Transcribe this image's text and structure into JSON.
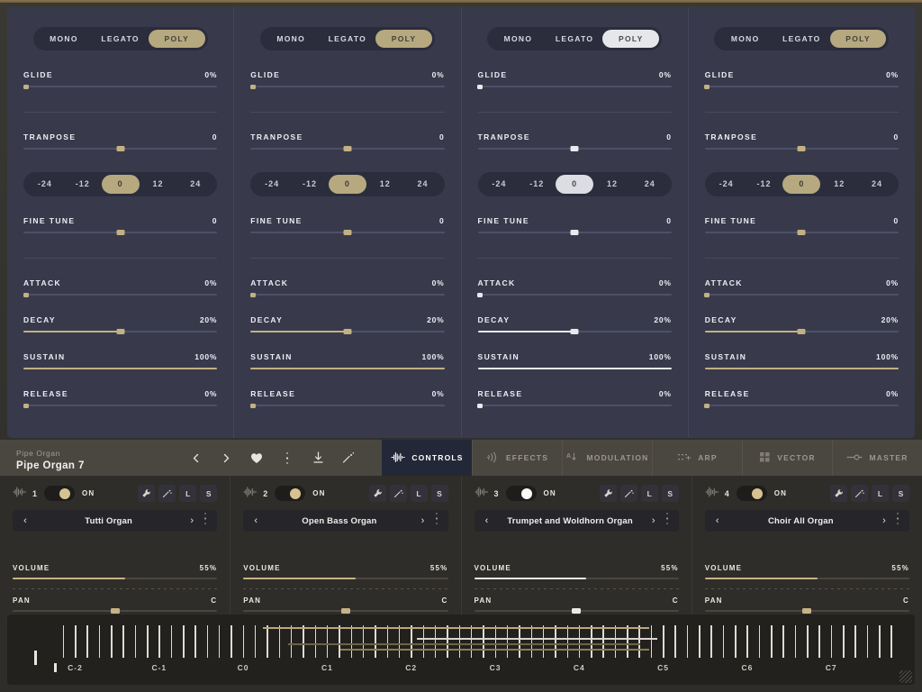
{
  "colors": {
    "panel_bg": "#383a4b",
    "accent_gold": "#c2b183",
    "accent_white": "#e9eaee",
    "toolbar_bg": "#4a4741",
    "tab_active_bg": "#232838",
    "wood": "#8a7550"
  },
  "panels": [
    {
      "active": false,
      "mode": {
        "options": [
          "MONO",
          "LEGATO",
          "POLY"
        ],
        "selected": "POLY"
      },
      "glide": {
        "label": "GLIDE",
        "value": "0%",
        "pct": 0
      },
      "transpose": {
        "label": "TRANPOSE",
        "value": "0",
        "pct": 50
      },
      "transpose_steps": {
        "options": [
          "-24",
          "-12",
          "0",
          "12",
          "24"
        ],
        "selected": "0"
      },
      "fine_tune": {
        "label": "FINE TUNE",
        "value": "0",
        "pct": 50
      },
      "attack": {
        "label": "ATTACK",
        "value": "0%",
        "pct": 0
      },
      "decay": {
        "label": "DECAY",
        "value": "20%",
        "pct": 50
      },
      "sustain": {
        "label": "SUSTAIN",
        "value": "100%",
        "pct": 100
      },
      "release": {
        "label": "RELEASE",
        "value": "0%",
        "pct": 0
      }
    },
    {
      "active": false,
      "mode": {
        "options": [
          "MONO",
          "LEGATO",
          "POLY"
        ],
        "selected": "POLY"
      },
      "glide": {
        "label": "GLIDE",
        "value": "0%",
        "pct": 0
      },
      "transpose": {
        "label": "TRANPOSE",
        "value": "0",
        "pct": 50
      },
      "transpose_steps": {
        "options": [
          "-24",
          "-12",
          "0",
          "12",
          "24"
        ],
        "selected": "0"
      },
      "fine_tune": {
        "label": "FINE TUNE",
        "value": "0",
        "pct": 50
      },
      "attack": {
        "label": "ATTACK",
        "value": "0%",
        "pct": 0
      },
      "decay": {
        "label": "DECAY",
        "value": "20%",
        "pct": 50
      },
      "sustain": {
        "label": "SUSTAIN",
        "value": "100%",
        "pct": 100
      },
      "release": {
        "label": "RELEASE",
        "value": "0%",
        "pct": 0
      }
    },
    {
      "active": true,
      "mode": {
        "options": [
          "MONO",
          "LEGATO",
          "POLY"
        ],
        "selected": "POLY"
      },
      "glide": {
        "label": "GLIDE",
        "value": "0%",
        "pct": 0
      },
      "transpose": {
        "label": "TRANPOSE",
        "value": "0",
        "pct": 50
      },
      "transpose_steps": {
        "options": [
          "-24",
          "-12",
          "0",
          "12",
          "24"
        ],
        "selected": "0"
      },
      "fine_tune": {
        "label": "FINE TUNE",
        "value": "0",
        "pct": 50
      },
      "attack": {
        "label": "ATTACK",
        "value": "0%",
        "pct": 0
      },
      "decay": {
        "label": "DECAY",
        "value": "20%",
        "pct": 50
      },
      "sustain": {
        "label": "SUSTAIN",
        "value": "100%",
        "pct": 100
      },
      "release": {
        "label": "RELEASE",
        "value": "0%",
        "pct": 0
      }
    },
    {
      "active": false,
      "mode": {
        "options": [
          "MONO",
          "LEGATO",
          "POLY"
        ],
        "selected": "POLY"
      },
      "glide": {
        "label": "GLIDE",
        "value": "0%",
        "pct": 0
      },
      "transpose": {
        "label": "TRANPOSE",
        "value": "0",
        "pct": 50
      },
      "transpose_steps": {
        "options": [
          "-24",
          "-12",
          "0",
          "12",
          "24"
        ],
        "selected": "0"
      },
      "fine_tune": {
        "label": "FINE TUNE",
        "value": "0",
        "pct": 50
      },
      "attack": {
        "label": "ATTACK",
        "value": "0%",
        "pct": 0
      },
      "decay": {
        "label": "DECAY",
        "value": "20%",
        "pct": 50
      },
      "sustain": {
        "label": "SUSTAIN",
        "value": "100%",
        "pct": 100
      },
      "release": {
        "label": "RELEASE",
        "value": "0%",
        "pct": 0
      }
    }
  ],
  "toolbar": {
    "preset_category": "Pipe Organ",
    "preset_name": "Pipe Organ 7",
    "icons": [
      {
        "name": "prev-preset-icon",
        "glyph": "prev"
      },
      {
        "name": "next-preset-icon",
        "glyph": "next"
      },
      {
        "name": "favorite-heart-icon",
        "glyph": "heart"
      },
      {
        "name": "more-options-icon",
        "glyph": "dots"
      },
      {
        "name": "download-icon",
        "glyph": "download"
      },
      {
        "name": "randomize-icon",
        "glyph": "sparkle"
      }
    ],
    "tabs": [
      {
        "label": "CONTROLS",
        "icon": "waveform-icon",
        "active": true
      },
      {
        "label": "EFFECTS",
        "icon": "signal-icon",
        "active": false
      },
      {
        "label": "MODULATION",
        "icon": "modulation-icon",
        "active": false
      },
      {
        "label": "ARP",
        "icon": "arp-icon",
        "active": false
      },
      {
        "label": "VECTOR",
        "icon": "grid-icon",
        "active": false
      },
      {
        "label": "MASTER",
        "icon": "master-icon",
        "active": false
      }
    ]
  },
  "layers": [
    {
      "number": "1",
      "power": "ON",
      "enabled": true,
      "active": false,
      "buttons": [
        "wrench-icon",
        "arrows-icon",
        "L",
        "S"
      ],
      "preset": "Tutti Organ",
      "volume": {
        "label": "VOLUME",
        "value": "55%",
        "pct": 55
      },
      "pan": {
        "label": "PAN",
        "value": "C",
        "pct": 50
      }
    },
    {
      "number": "2",
      "power": "ON",
      "enabled": true,
      "active": false,
      "buttons": [
        "wrench-icon",
        "arrows-icon",
        "L",
        "S"
      ],
      "preset": "Open Bass Organ",
      "volume": {
        "label": "VOLUME",
        "value": "55%",
        "pct": 55
      },
      "pan": {
        "label": "PAN",
        "value": "C",
        "pct": 50
      }
    },
    {
      "number": "3",
      "power": "ON",
      "enabled": true,
      "active": true,
      "buttons": [
        "wrench-icon",
        "arrows-icon",
        "L",
        "S"
      ],
      "preset": "Trumpet and Woldhorn Organ",
      "volume": {
        "label": "VOLUME",
        "value": "55%",
        "pct": 55
      },
      "pan": {
        "label": "PAN",
        "value": "C",
        "pct": 50
      }
    },
    {
      "number": "4",
      "power": "ON",
      "enabled": true,
      "active": false,
      "buttons": [
        "wrench-icon",
        "arrows-icon",
        "L",
        "S"
      ],
      "preset": "Choir All Organ",
      "volume": {
        "label": "VOLUME",
        "value": "55%",
        "pct": 55
      },
      "pan": {
        "label": "PAN",
        "value": "C",
        "pct": 50
      }
    }
  ],
  "keyboard": {
    "octave_labels": [
      "C-2",
      "C-1",
      "C0",
      "C1",
      "C2",
      "C3",
      "C4",
      "C5",
      "C6",
      "C7"
    ],
    "label_positions_pct": [
      6.2,
      15.4,
      26.0,
      34.8,
      44.0,
      62.6,
      62.6,
      72.0,
      81.4,
      71.0
    ],
    "ranges": [
      {
        "color": "#b9a87c",
        "start_pct": 24.0,
        "end_pct": 69.0,
        "offset": 2
      },
      {
        "color": "#d9d6cf",
        "start_pct": 42.0,
        "end_pct": 70.0,
        "offset": 14
      },
      {
        "color": "#8d7c52",
        "start_pct": 33.0,
        "end_pct": 69.0,
        "offset": 26
      },
      {
        "color": "#6d6348",
        "start_pct": 27.0,
        "end_pct": 68.0,
        "offset": 20
      }
    ]
  }
}
